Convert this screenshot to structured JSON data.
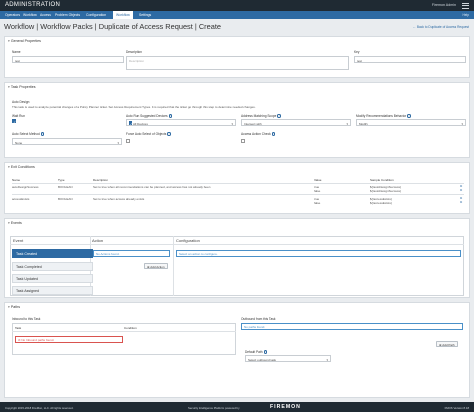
{
  "app": {
    "title": "ADMINISTRATION",
    "user": "Firemon Admin"
  },
  "nav": {
    "items": [
      "Operators",
      "Workflow",
      "Access",
      "Problem Objects",
      "Configuration",
      "Workflow",
      "Settings"
    ],
    "active_index": 5,
    "right": "Help"
  },
  "page": {
    "title": "Workflow | Workflow Packs | Duplicate of Access Request | Create",
    "back": "← Back to Duplicate of Access Request"
  },
  "general": {
    "title": "General Properties",
    "name_label": "Name",
    "name_value": "test",
    "description_label": "Description",
    "description_placeholder": "Description",
    "key_label": "Key",
    "key_value": "test"
  },
  "task": {
    "title": "Task Properties",
    "section_label": "Auto Design",
    "description": "This task is used to analyze potential changes of a Policy Planner ticket. Set Access Requirement Types. It is required that the ticket go through this step to determine needed changes.",
    "fields": {
      "wait_run": "Wait Run",
      "auto_run": "Auto Run Suggested Devices",
      "auto_run_value": "All Devices",
      "matching": "Address Matching Scope",
      "matching_value": "Intersect with",
      "modify": "Modify Recommendations Behavior",
      "modify_value": "Modify",
      "select_method": "Auto Select Method",
      "select_method_value": "None",
      "force": "Force Auto Select of Objects",
      "access_check": "Access Action Check"
    }
  },
  "exit": {
    "title": "Exit Conditions",
    "columns": [
      "Name",
      "Type",
      "Description",
      "Value",
      "Sample Condition"
    ],
    "rows": [
      {
        "name": "autoDesignSuccess",
        "type": "BOOLEAN",
        "desc": "Set to true when all recommendations can be planned, and access has not already been",
        "values": [
          "true",
          "false"
        ],
        "samples": [
          "${!autoDesignSuccess}",
          "${!autoDesignSuccess}"
        ]
      },
      {
        "name": "accessExists",
        "type": "BOOLEAN",
        "desc": "Set to true when access already exists",
        "values": [
          "true",
          "false"
        ],
        "samples": [
          "${!accessExists}",
          "${!accessExists}"
        ]
      }
    ]
  },
  "events": {
    "title": "Events",
    "event_header": "Event",
    "action_header": "Action",
    "config_header": "Configuration",
    "items": [
      "Task Created",
      "Task Completed",
      "Task Updated",
      "Task Assigned"
    ],
    "active_index": 0,
    "no_actions": "No Actions found.",
    "add_action": "Add Action",
    "config_hint": "Select an action to configure."
  },
  "paths": {
    "title": "Paths",
    "inbound_label": "Inbound to this Task",
    "inbound_columns": [
      "Task",
      "Condition"
    ],
    "inbound_empty": "No Inbound paths found.",
    "outbound_label": "Outbound from this Task",
    "outbound_empty": "No paths found.",
    "add_path": "Add Path",
    "default_label": "Default Path",
    "default_value": "Select outbound task"
  },
  "footer": {
    "copyright": "Copyright 2015-2018 FireMon, LLC. All rights reserved.",
    "platform": "Security Intelligence Platform",
    "powered": "powered by",
    "brand": "FIREMON",
    "version": "FMOS Version 8.18"
  }
}
